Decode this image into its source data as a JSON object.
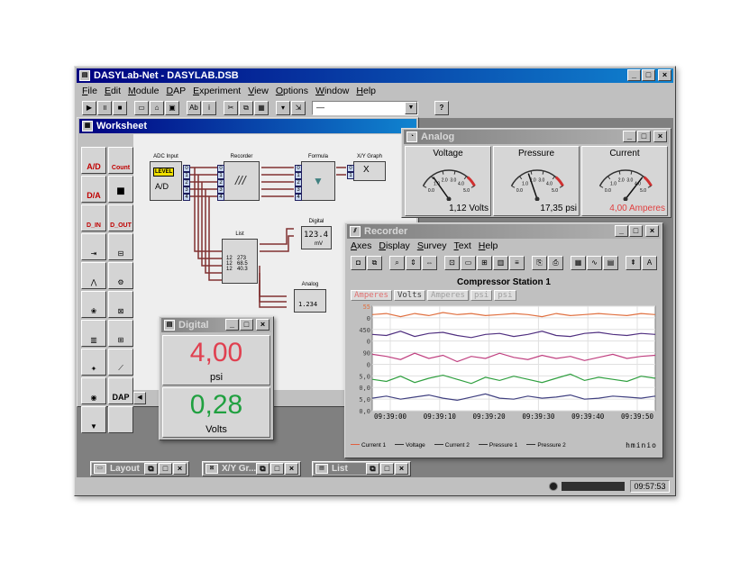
{
  "app": {
    "title": "DASYLab-Net - DASYLAB.DSB",
    "menu": [
      "File",
      "Edit",
      "Module",
      "DAP",
      "Experiment",
      "View",
      "Options",
      "Window",
      "Help"
    ],
    "toolbar_icons": [
      "play",
      "pause",
      "stop",
      "new",
      "open",
      "save",
      "text",
      "info",
      "cut",
      "copy",
      "paste",
      "up",
      "down",
      "combo-dropdown",
      "help"
    ],
    "combo_value": "—",
    "help_glyph": "?",
    "clock": "09:57:53"
  },
  "worksheet": {
    "title": "Worksheet",
    "palette": [
      {
        "label": "A/D",
        "icon": "ad-icon"
      },
      {
        "label": "Count",
        "icon": "counter-icon"
      },
      {
        "label": "D/A",
        "icon": "da-icon"
      },
      {
        "label": "",
        "icon": "cube-icon"
      },
      {
        "label": "D_IN",
        "icon": "digital-in-icon"
      },
      {
        "label": "D_OUT",
        "icon": "digital-out-icon"
      },
      {
        "label": "",
        "icon": "trigger-icon"
      },
      {
        "label": "",
        "icon": "switch-icon"
      },
      {
        "label": "",
        "icon": "signal-icon"
      },
      {
        "label": "",
        "icon": "gear-icon"
      },
      {
        "label": "",
        "icon": "filter-icon"
      },
      {
        "label": "",
        "icon": "relay-icon"
      },
      {
        "label": "",
        "icon": "display-icon"
      },
      {
        "label": "",
        "icon": "chart-icon"
      },
      {
        "label": "",
        "icon": "network-icon"
      },
      {
        "label": "",
        "icon": "file-icon"
      },
      {
        "label": "",
        "icon": "clock-icon"
      },
      {
        "label": "DAP",
        "icon": "dap-icon"
      },
      {
        "label": "",
        "icon": "funnel-icon"
      },
      {
        "label": "",
        "icon": "blank-icon"
      }
    ],
    "blocks": {
      "adc": {
        "title": "ADC Input",
        "label": "A/D",
        "badge": "LEVEL",
        "ports_out": [
          "0",
          "1",
          "2",
          "3",
          "4"
        ]
      },
      "recorder": {
        "title": "Recorder",
        "ports_in": [
          "0",
          "1",
          "2",
          "3",
          "4"
        ]
      },
      "formula": {
        "title": "Formula",
        "ports_in": [
          "0",
          "1",
          "2",
          "3",
          "4"
        ],
        "ports_out": [
          "0",
          "1",
          "2",
          "3",
          "4"
        ]
      },
      "xygraph": {
        "title": "X/Y Graph",
        "ports_in": [
          "0",
          "1"
        ],
        "label": "X"
      },
      "list": {
        "title": "List",
        "ports_in": [
          "0",
          "1",
          "2",
          "3",
          "4"
        ],
        "ports_out": [
          "0",
          "1",
          "2",
          "3",
          "4"
        ],
        "cells": [
          "12",
          "273",
          "12",
          "68.5",
          "12",
          "40.3"
        ]
      },
      "digital": {
        "title": "Digital",
        "ports_in": [
          "0",
          "1"
        ],
        "value": "123.4",
        "unit": "mV"
      },
      "analog": {
        "title": "Analog",
        "ports_in": [
          "0",
          "1",
          "2"
        ],
        "value": "1.234"
      }
    }
  },
  "analog_window": {
    "title": "Analog",
    "meters": [
      {
        "label": "Voltage",
        "value": "1,12 Volts",
        "ticks": [
          "0.0",
          "1.0",
          "2.0",
          "3.0",
          "4.0",
          "5.0"
        ],
        "fraction": 0.22,
        "value_color": "#000000"
      },
      {
        "label": "Pressure",
        "value": "17,35 psi",
        "ticks": [
          "0.0",
          "1.0",
          "2.0",
          "3.0",
          "4.0",
          "5.0"
        ],
        "fraction": 0.35,
        "value_color": "#000000"
      },
      {
        "label": "Current",
        "value": "4,00 Amperes",
        "ticks": [
          "0.0",
          "1.0",
          "2.0",
          "3.0",
          "4.0",
          "5.0"
        ],
        "fraction": 0.8,
        "value_color": "#e04040"
      }
    ]
  },
  "digital_window": {
    "title": "Digital",
    "readouts": [
      {
        "value": "4,00",
        "unit": "psi",
        "color": "#e04050"
      },
      {
        "value": "0,28",
        "unit": "Volts",
        "color": "#20a040"
      }
    ]
  },
  "recorder_window": {
    "title": "Recorder",
    "menu": [
      "Axes",
      "Display",
      "Survey",
      "Text",
      "Help"
    ],
    "chart_title": "Compressor Station 1",
    "series_tabs": [
      "Amperes",
      "Volts",
      "Amperes",
      "psi",
      "psi"
    ],
    "logo": "hminio",
    "legend": [
      {
        "name": "Current 1",
        "color": "#e06040"
      },
      {
        "name": "Voltage",
        "color": "#303030"
      },
      {
        "name": "Current 2",
        "color": "#303030"
      },
      {
        "name": "Pressure 1",
        "color": "#303030"
      },
      {
        "name": "Pressure 2",
        "color": "#303030"
      }
    ]
  },
  "chart_data": {
    "type": "line",
    "title": "Compressor Station 1",
    "x": [
      "09:39:00",
      "09:39:10",
      "09:39:20",
      "09:39:30",
      "09:39:40",
      "09:39:50"
    ],
    "y_ticks": [
      "55",
      "0",
      "450",
      "0",
      "90",
      "0",
      "5,0",
      "0,0",
      "5,0",
      "0,0"
    ],
    "grid": true,
    "legend_position": "bottom",
    "series": [
      {
        "name": "Current 1",
        "color": "#e07040",
        "values": [
          0.92,
          0.93,
          0.9,
          0.93,
          0.91,
          0.94,
          0.92,
          0.93,
          0.91,
          0.92,
          0.93,
          0.92,
          0.9,
          0.93,
          0.91,
          0.92,
          0.93,
          0.92,
          0.91,
          0.93,
          0.92
        ]
      },
      {
        "name": "Voltage",
        "color": "#503080",
        "values": [
          0.73,
          0.72,
          0.76,
          0.71,
          0.74,
          0.75,
          0.72,
          0.7,
          0.73,
          0.74,
          0.71,
          0.73,
          0.76,
          0.72,
          0.71,
          0.74,
          0.75,
          0.73,
          0.72,
          0.74,
          0.73
        ]
      },
      {
        "name": "Current 2",
        "color": "#c04080",
        "values": [
          0.54,
          0.52,
          0.49,
          0.55,
          0.5,
          0.53,
          0.47,
          0.52,
          0.5,
          0.55,
          0.51,
          0.49,
          0.53,
          0.5,
          0.52,
          0.48,
          0.51,
          0.54,
          0.5,
          0.52,
          0.53
        ]
      },
      {
        "name": "Pressure 1",
        "color": "#30a040",
        "values": [
          0.3,
          0.28,
          0.33,
          0.27,
          0.31,
          0.34,
          0.3,
          0.26,
          0.32,
          0.29,
          0.33,
          0.3,
          0.27,
          0.31,
          0.35,
          0.29,
          0.32,
          0.3,
          0.28,
          0.33,
          0.31
        ]
      },
      {
        "name": "Pressure 2",
        "color": "#404080",
        "values": [
          0.12,
          0.14,
          0.11,
          0.13,
          0.15,
          0.12,
          0.1,
          0.13,
          0.16,
          0.12,
          0.11,
          0.14,
          0.12,
          0.13,
          0.15,
          0.11,
          0.12,
          0.14,
          0.13,
          0.12,
          0.14
        ]
      }
    ]
  },
  "minimized": [
    {
      "title": "Layout",
      "icon": "layout-icon"
    },
    {
      "title": "X/Y Gr...",
      "icon": "xy-icon"
    },
    {
      "title": "List",
      "icon": "list-icon"
    }
  ]
}
